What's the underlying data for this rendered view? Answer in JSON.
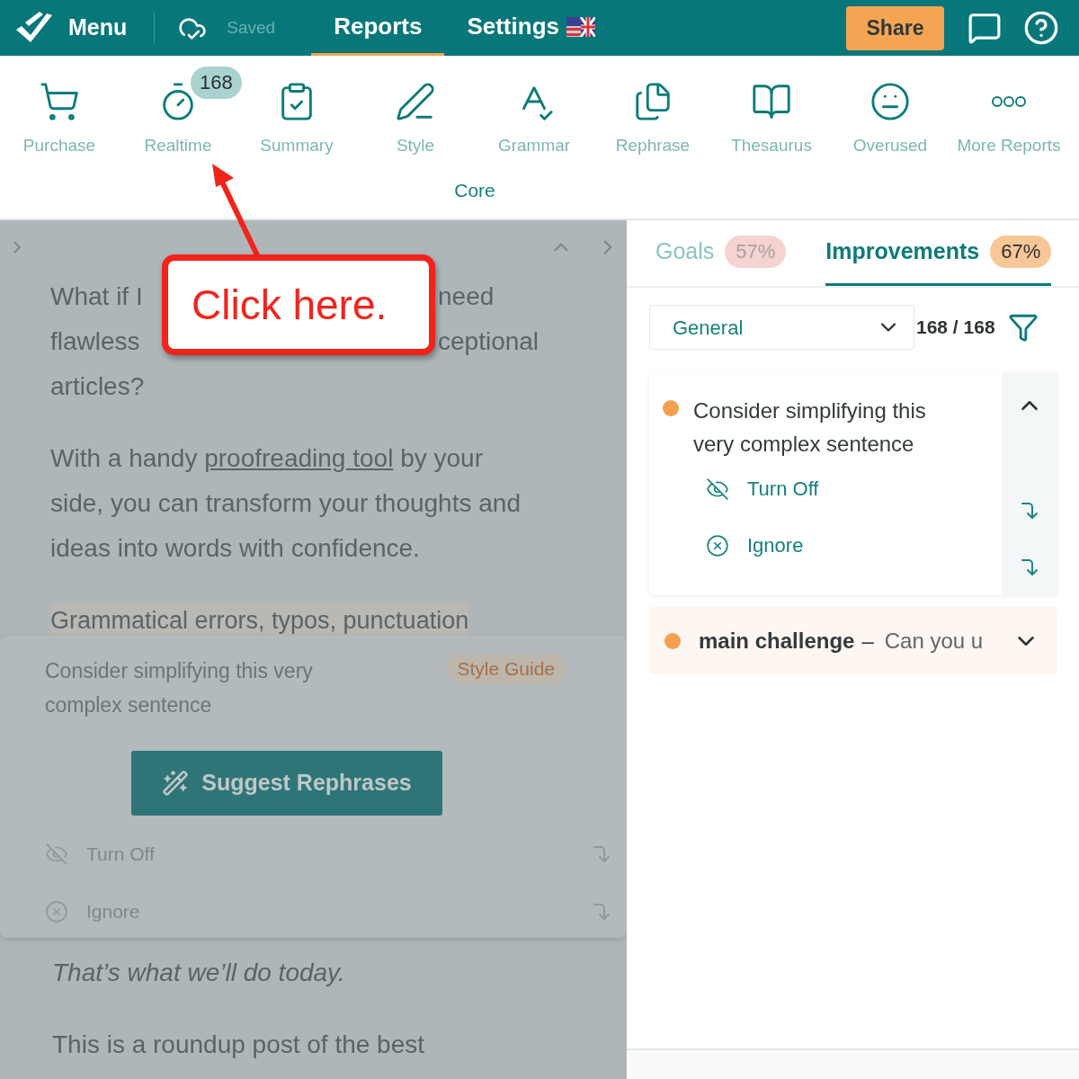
{
  "header": {
    "menu_label": "Menu",
    "save_status": "Saved",
    "tabs": [
      {
        "label": "Reports",
        "selected": true,
        "flag": false
      },
      {
        "label": "Settings",
        "selected": false,
        "flag": true
      }
    ],
    "share_button": "Share"
  },
  "toolbar": {
    "items": [
      {
        "kind": "cart",
        "label": "Purchase"
      },
      {
        "kind": "stopwatch",
        "label": "Realtime",
        "badge": "168"
      },
      {
        "kind": "clipboard",
        "label": "Summary"
      },
      {
        "kind": "pen",
        "label": "Style"
      },
      {
        "kind": "spellcheck",
        "label": "Grammar"
      },
      {
        "kind": "documents",
        "label": "Rephrase"
      },
      {
        "kind": "book",
        "label": "Thesaurus"
      },
      {
        "kind": "face",
        "label": "Overused"
      },
      {
        "kind": "dots",
        "label": "More Reports"
      }
    ],
    "group_label": "Core"
  },
  "editor": {
    "intro_lines": [
      {
        "left": "What if I",
        "right": "need"
      },
      {
        "left": "flawless",
        "right": "ceptional"
      },
      {
        "left": "articles?"
      }
    ],
    "paragraph": {
      "before": "With a handy ",
      "link": "proofreading tool",
      "after": " by your side, you can transform your thoughts and ideas into words with confidence."
    },
    "highlighted_line": "Grammatical errors, typos, punctuation",
    "popup": {
      "message": "Consider simplifying this very complex sentence",
      "tag": "Style Guide",
      "button": "Suggest Rephrases",
      "actions": [
        {
          "kind": "turn_off",
          "label": "Turn Off"
        },
        {
          "kind": "ignore",
          "label": "Ignore"
        }
      ]
    },
    "closing_lines": [
      {
        "text": "That’s what we’ll do today.",
        "italic": true
      },
      {
        "text": "This is a roundup post of the best",
        "italic": false
      }
    ]
  },
  "callout": {
    "text": "Click here."
  },
  "panel": {
    "tabs": [
      {
        "label": "Goals",
        "badge": "57%",
        "selected": false,
        "color": "#f5d3d1"
      },
      {
        "label": "Improvements",
        "badge": "67%",
        "selected": true,
        "color": "#f7c797"
      }
    ],
    "filter": {
      "value": "General",
      "count": "168 / 168"
    },
    "cards": [
      {
        "title": "Consider simplifying this very complex sentence",
        "expanded": true,
        "actions": [
          {
            "kind": "turn_off",
            "label": "Turn Off"
          },
          {
            "kind": "ignore",
            "label": "Ignore"
          }
        ]
      },
      {
        "title": "main challenge",
        "separator": "–",
        "preview": "Can you u",
        "expanded": false
      }
    ]
  }
}
